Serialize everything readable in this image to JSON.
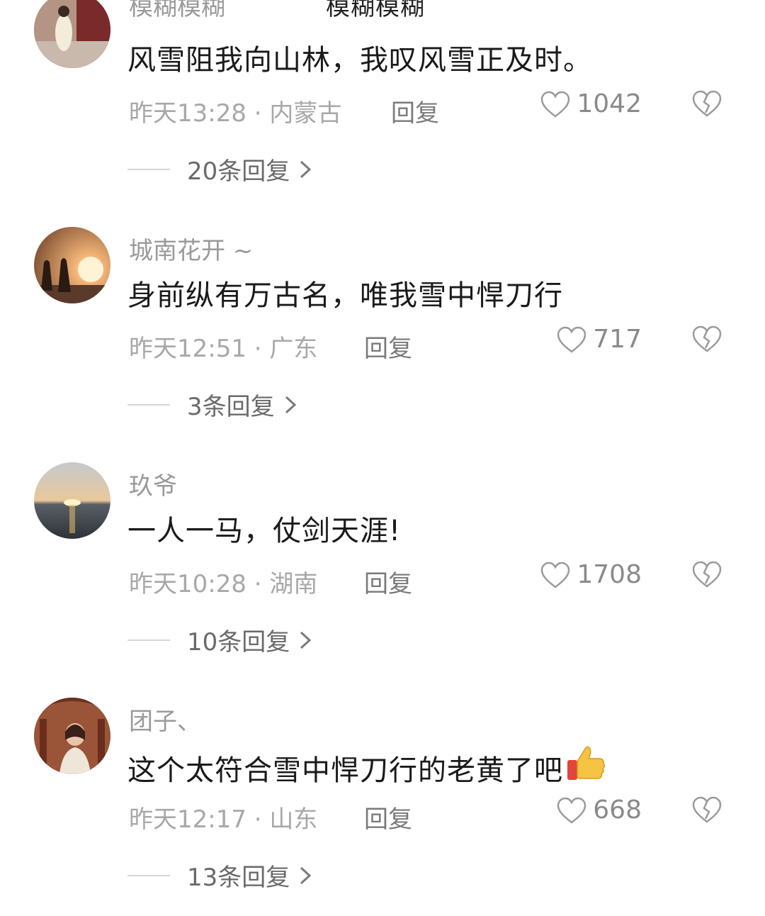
{
  "header": {
    "partial_text": "模糊模糊"
  },
  "comments": [
    {
      "username": "模糊模糊",
      "text": "风雪阻我向山林，我叹风雪正及时。",
      "meta": "昨天13:28 · 内蒙古",
      "reply_label": "回复",
      "likes": "1042",
      "replies_label": "20条回复"
    },
    {
      "username": "城南花开 ~",
      "text": "身前纵有万古名，唯我雪中悍刀行",
      "meta": "昨天12:51 · 广东",
      "reply_label": "回复",
      "likes": "717",
      "replies_label": "3条回复"
    },
    {
      "username": "玖爷",
      "text": "一人一马，仗剑天涯!",
      "meta": "昨天10:28 · 湖南",
      "reply_label": "回复",
      "likes": "1708",
      "replies_label": "10条回复"
    },
    {
      "username": "团子、",
      "text": "这个太符合雪中悍刀行的老黄了吧",
      "meta": "昨天12:17 · 山东",
      "reply_label": "回复",
      "likes": "668",
      "replies_label": "13条回复"
    }
  ],
  "icons": {
    "like": "heart-outline-icon",
    "dislike": "broken-heart-icon",
    "chevron": "chevron-right-icon",
    "emoji": "thumbs-up-emoji"
  }
}
